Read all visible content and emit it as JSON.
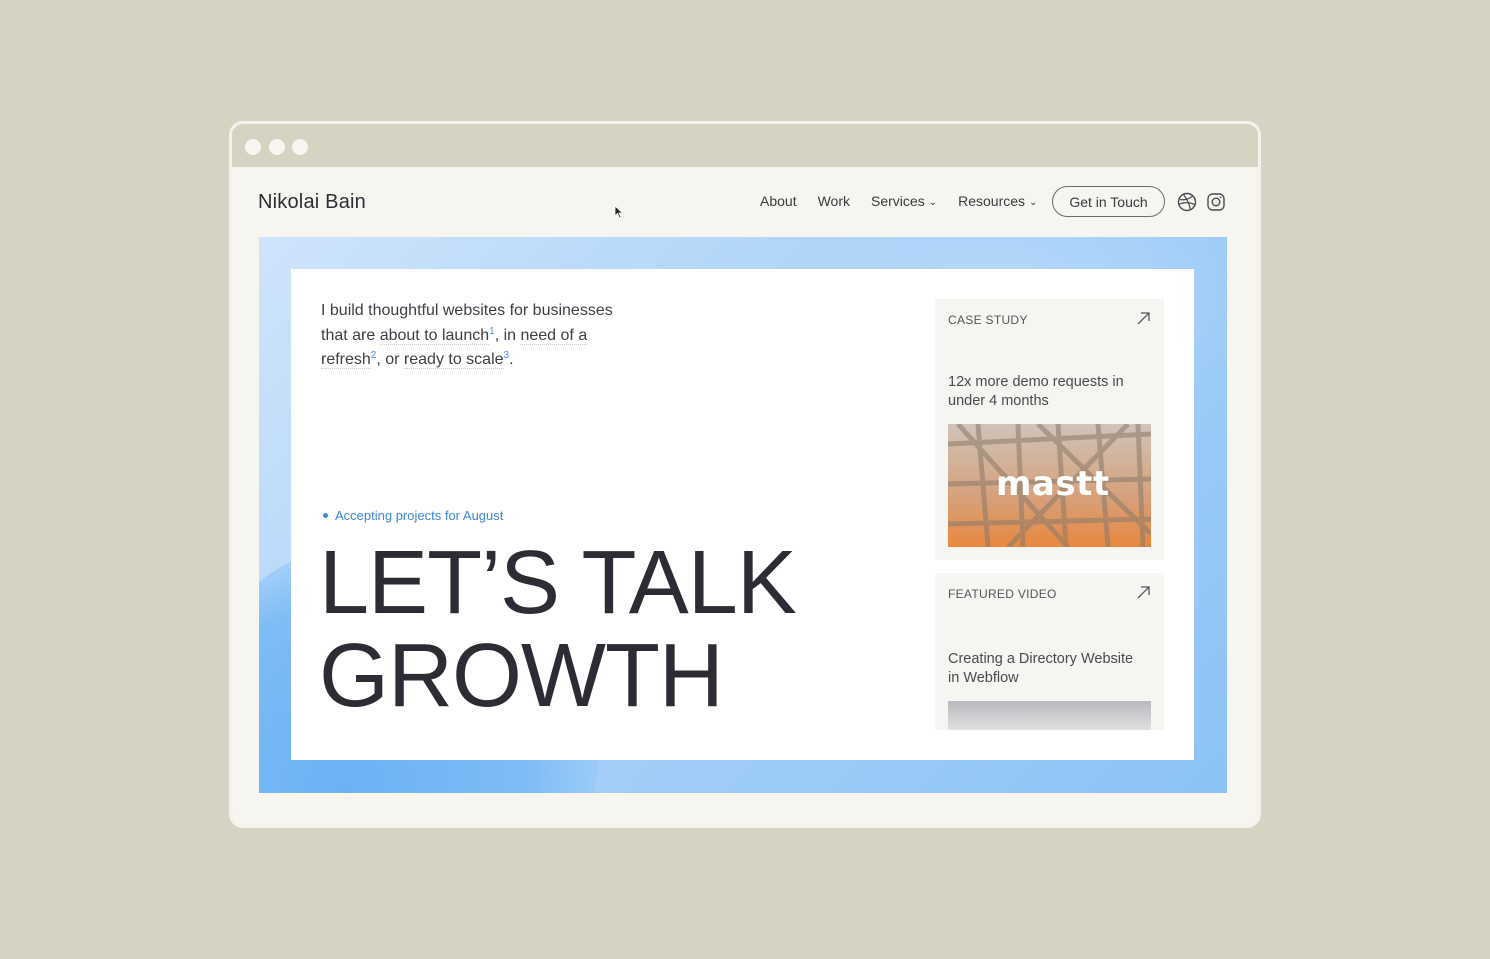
{
  "site": {
    "brand": "Nikolai Bain",
    "nav": [
      {
        "label": "About"
      },
      {
        "label": "Work"
      },
      {
        "label": "Services"
      },
      {
        "label": "Resources"
      }
    ],
    "cta_label": "Get in Touch",
    "social_icons": [
      "dribbble-icon",
      "instagram-icon"
    ]
  },
  "hero": {
    "intro_part1": "I build thoughtful websites for businesses that are ",
    "launch_text": "about to launch",
    "sup1": "1",
    "sep1": ", in ",
    "refresh_text": "need of a refresh",
    "sup2": "2",
    "sep2": ", or ",
    "scale_text": "ready to scale",
    "sup3": "3",
    "end": ".",
    "status": "Accepting projects for August",
    "headline_line1": "LET’S TALK",
    "headline_line2": "GROWTH"
  },
  "cards": {
    "case_study": {
      "label": "CASE STUDY",
      "title": "12x more demo requests in under 4 months",
      "logo": "mastt"
    },
    "featured_video": {
      "label": "FEATURED VIDEO",
      "title": "Creating a Directory Website in Webflow"
    }
  },
  "colors": {
    "background": "#d6d3c2",
    "accent": "#3d86d8",
    "hero_gradient": "#8cc2f5"
  }
}
